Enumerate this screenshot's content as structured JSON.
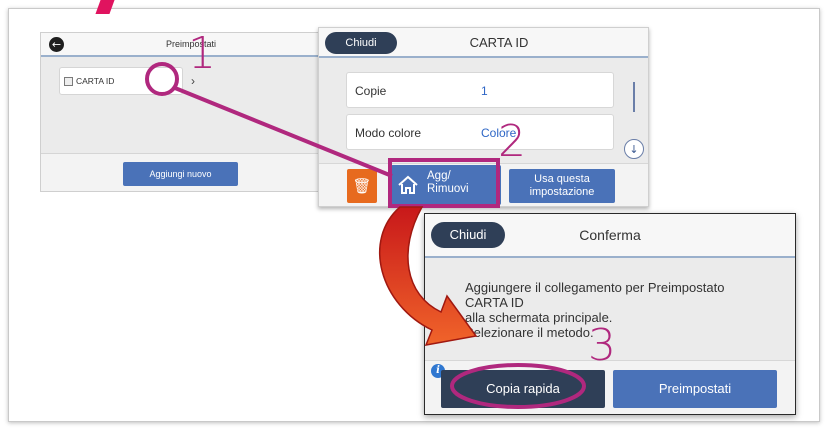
{
  "panel1": {
    "title": "Preimpostati",
    "item_label": "CARTA ID",
    "item_chevron": "›",
    "add_button": "Aggiungi nuovo",
    "icons": {
      "back": "back-arrow-icon",
      "item": "id-card-icon",
      "chevron": "chevron-right-icon"
    }
  },
  "panel2": {
    "close_label": "Chiudi",
    "title": "CARTA ID",
    "rows": [
      {
        "label": "Copie",
        "value": "1"
      },
      {
        "label": "Modo colore",
        "value": "Colore"
      }
    ],
    "add_remove_label_1": "Agg/",
    "add_remove_label_2": "Rimuovi",
    "use_setting_label_1": "Usa questa",
    "use_setting_label_2": "impostazione",
    "icons": {
      "delete": "trash-icon",
      "home": "home-icon",
      "scroll": "arrow-down-icon"
    }
  },
  "panel3": {
    "close_label": "Chiudi",
    "title": "Conferma",
    "message_lines": [
      "Aggiungere il collegamento per Preimpostato",
      "CARTA ID",
      "alla schermata principale.",
      "Selezionare il metodo."
    ],
    "quick_copy_label": "Copia rapida",
    "presets_label": "Preimpostati",
    "icons": {
      "info": "info-icon"
    }
  },
  "annotations": {
    "step1": "1",
    "step2": "2",
    "step3": "3",
    "highlight_color": "#b0287e",
    "arrow_color": "#e0441f"
  },
  "colors": {
    "primary_button": "#4a72b8",
    "dark_button": "#2f3f57",
    "delete_button": "#e76a1e",
    "value_text": "#2f67c6"
  }
}
